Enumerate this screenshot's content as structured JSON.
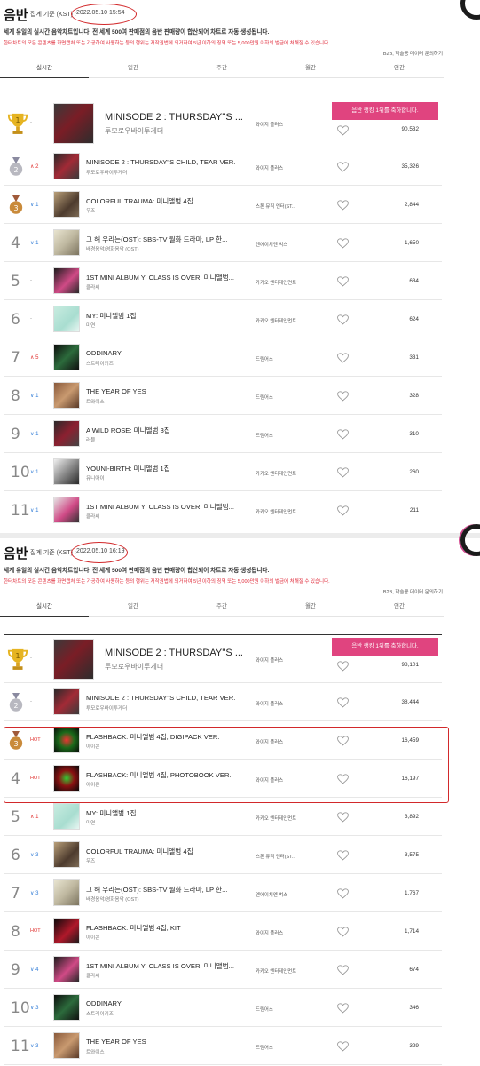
{
  "top": {
    "title": "음반",
    "time_label": "집계 기준 (KST) :",
    "time": "2022.05.10 15:54",
    "description": "세계 유일의 실시간 음악차트입니다. 전 세계 500여 판매점의 음반 판매량이 합산되어 차트로 자동 생성됩니다.",
    "warning": "한터차트의 모든 콘텐츠를 화면캡처 또는 가공하여 사용하는 등의 행위는 저작권법에 의거하여 5년 이하의 징역 또는 5,000만원 이하의 벌금에 처해질 수 있습니다.",
    "b2b": "B2B, 학술용 데이터 문의하기",
    "tabs": [
      "실시간",
      "일간",
      "주간",
      "월간",
      "연간"
    ],
    "congrats": "음반 랭킹 1위를 축하합니다.",
    "rows": [
      {
        "rank": "1",
        "change": "-",
        "title": "MINISODE 2 : THURSDAY''S ...",
        "artist": "투모로우바이투게더",
        "company": "와이지 플러스",
        "sales": "90,532"
      },
      {
        "rank": "2",
        "change": "2",
        "title": "MINISODE 2 : THURSDAY''S CHILD, TEAR VER.",
        "artist": "투모로우바이투게더",
        "company": "와이지 플러스",
        "sales": "35,326"
      },
      {
        "rank": "3",
        "change": "1",
        "title": "COLORFUL TRAUMA: 미니앨범 4집",
        "artist": "우즈",
        "company": "스톤 뮤직 엔터(ST...",
        "sales": "2,844"
      },
      {
        "rank": "4",
        "change": "1",
        "title": "그 해 우리는(OST): SBS-TV 월화 드라마, LP 한...",
        "artist": "배경음악/영화음악 (OST)",
        "company": "엔에이치엔 벅스",
        "sales": "1,650"
      },
      {
        "rank": "5",
        "change": "-",
        "title": "1ST MINI ALBUM Y: CLASS IS OVER: 미니앨범...",
        "artist": "클라씨",
        "company": "카카오 엔터테인먼트",
        "sales": "634"
      },
      {
        "rank": "6",
        "change": "-",
        "title": "MY: 미니앨범 1집",
        "artist": "미연",
        "company": "카카오 엔터테인먼트",
        "sales": "624"
      },
      {
        "rank": "7",
        "change": "5",
        "title": "ODDINARY",
        "artist": "스트레이키즈",
        "company": "드림어스",
        "sales": "331"
      },
      {
        "rank": "8",
        "change": "1",
        "title": "THE YEAR OF YES",
        "artist": "트와이스",
        "company": "드림어스",
        "sales": "328"
      },
      {
        "rank": "9",
        "change": "1",
        "title": "A WILD ROSE: 미니앨범 3집",
        "artist": "러블",
        "company": "드림어스",
        "sales": "310"
      },
      {
        "rank": "10",
        "change": "1",
        "title": "YOUNI-BIRTH: 미니앨범 1집",
        "artist": "유니아이",
        "company": "카카오 엔터테인먼트",
        "sales": "260"
      },
      {
        "rank": "11",
        "change": "1",
        "title": "1ST MINI ALBUM Y: CLASS IS OVER: 미니앨범...",
        "artist": "클라씨",
        "company": "카카오 엔터테인먼트",
        "sales": "211"
      }
    ]
  },
  "bottom": {
    "title": "음반",
    "time_label": "집계 기준 (KST) :",
    "time": "2022.05.10 16:19",
    "description": "세계 유일의 실시간 음악차트입니다. 전 세계 500여 판매점의 음반 판매량이 합산되어 차트로 자동 생성됩니다.",
    "warning": "한터차트의 모든 콘텐츠를 화면캡처 또는 가공하여 사용하는 등의 행위는 저작권법에 의거하여 5년 이하의 징역 또는 5,000만원 이하의 벌금에 처해질 수 있습니다.",
    "b2b": "B2B, 학술용 데이터 문의하기",
    "tabs": [
      "실시간",
      "일간",
      "주간",
      "월간",
      "연간"
    ],
    "congrats": "음반 랭킹 1위를 축하합니다.",
    "rows": [
      {
        "rank": "1",
        "change": "-",
        "title": "MINISODE 2 : THURSDAY''S ...",
        "artist": "투모로우바이투게더",
        "company": "와이지 플러스",
        "sales": "98,101"
      },
      {
        "rank": "2",
        "change": "-",
        "title": "MINISODE 2 : THURSDAY''S CHILD, TEAR VER.",
        "artist": "투모로우바이투게더",
        "company": "와이지 플러스",
        "sales": "38,444"
      },
      {
        "rank": "3",
        "change": "HOT",
        "title": "FLASHBACK: 미니앨범 4집, DIGIPACK VER.",
        "artist": "아이콘",
        "company": "와이지 플러스",
        "sales": "16,459"
      },
      {
        "rank": "4",
        "change": "HOT",
        "title": "FLASHBACK: 미니앨범 4집, PHOTOBOOK VER.",
        "artist": "아이콘",
        "company": "와이지 플러스",
        "sales": "16,197"
      },
      {
        "rank": "5",
        "change": "1",
        "title": "MY: 미니앨범 1집",
        "artist": "미연",
        "company": "카카오 엔터테인먼트",
        "sales": "3,892"
      },
      {
        "rank": "6",
        "change": "3",
        "title": "COLORFUL TRAUMA: 미니앨범 4집",
        "artist": "우즈",
        "company": "스톤 뮤직 엔터(ST...",
        "sales": "3,575"
      },
      {
        "rank": "7",
        "change": "3",
        "title": "그 해 우리는(OST): SBS-TV 월화 드라마, LP 한...",
        "artist": "배경음악/영화음악 (OST)",
        "company": "엔에이치엔 벅스",
        "sales": "1,767"
      },
      {
        "rank": "8",
        "change": "HOT",
        "title": "FLASHBACK: 미니앨범 4집, KIT",
        "artist": "아이콘",
        "company": "와이지 플러스",
        "sales": "1,714"
      },
      {
        "rank": "9",
        "change": "4",
        "title": "1ST MINI ALBUM Y: CLASS IS OVER: 미니앨범...",
        "artist": "클라씨",
        "company": "카카오 엔터테인먼트",
        "sales": "674"
      },
      {
        "rank": "10",
        "change": "3",
        "title": "ODDINARY",
        "artist": "스트레이키즈",
        "company": "드림어스",
        "sales": "346"
      },
      {
        "rank": "11",
        "change": "3",
        "title": "THE YEAR OF YES",
        "artist": "트와이스",
        "company": "드림어스",
        "sales": "329"
      }
    ]
  },
  "colors": {
    "accent_pink": "#e0447f",
    "annotation_red": "#d2292b",
    "rank_up": "#e0312f",
    "rank_down": "#2f7bd6"
  }
}
